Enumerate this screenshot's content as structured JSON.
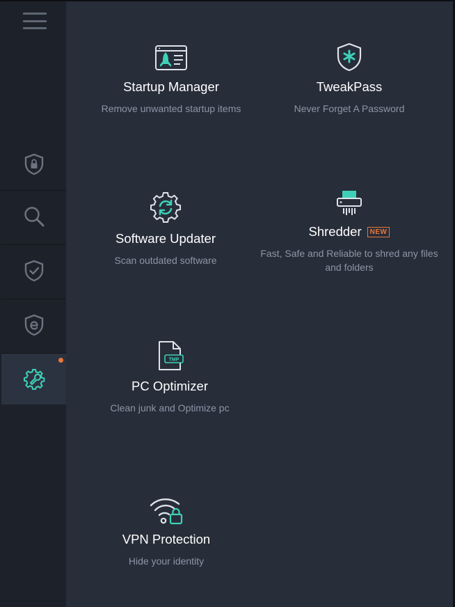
{
  "sidebar": {
    "items": [
      {
        "name": "shield-lock"
      },
      {
        "name": "search"
      },
      {
        "name": "shield-check"
      },
      {
        "name": "shield-e"
      },
      {
        "name": "tools",
        "active": true,
        "notification": true
      }
    ]
  },
  "tiles": {
    "startup": {
      "title": "Startup Manager",
      "desc": "Remove unwanted startup items"
    },
    "tweakpass": {
      "title": "TweakPass",
      "desc": "Never Forget A Password"
    },
    "updater": {
      "title": "Software Updater",
      "desc": "Scan outdated software"
    },
    "shredder": {
      "title": "Shredder",
      "badge": "NEW",
      "desc": "Fast, Safe and Reliable to shred any files and folders"
    },
    "optimizer": {
      "title": "PC Optimizer",
      "desc": "Clean junk and Optimize pc",
      "icon_label": "TMP"
    },
    "vpn": {
      "title": "VPN Protection",
      "desc": "Hide your identity"
    }
  },
  "colors": {
    "accent": "#3ed1b8",
    "badge": "#e8773a",
    "panel": "#272d39",
    "sidebar": "#1d222a"
  }
}
